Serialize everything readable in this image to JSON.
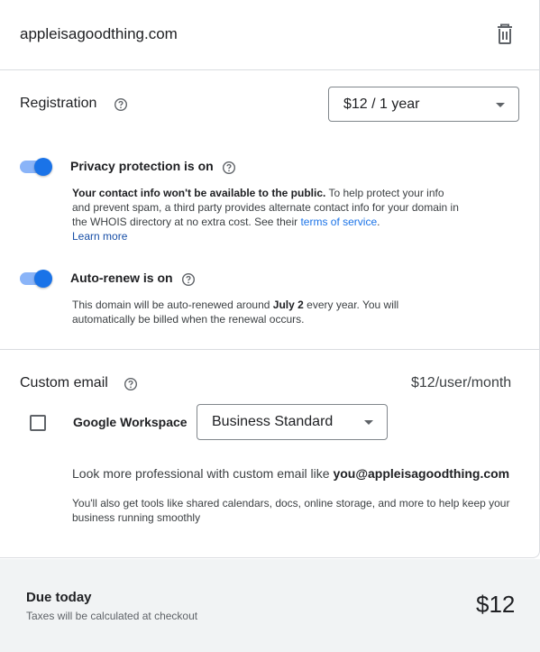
{
  "domain": {
    "name": "appleisagoodthing.com",
    "delete_icon": "trash-icon"
  },
  "registration": {
    "title": "Registration",
    "help_icon": "help-circle-icon",
    "selected_plan": "$12 / 1 year"
  },
  "privacy": {
    "label": "Privacy protection is on",
    "enabled": true,
    "desc_bold": "Your contact info won't be available to the public.",
    "desc_text": " To help protect your info and prevent spam, a third party provides alternate contact info for your domain in the WHOIS directory at no extra cost. See their ",
    "terms_link": "terms of service",
    "desc_end": ".",
    "learn_more": "Learn more"
  },
  "autorenew": {
    "label": "Auto-renew is on",
    "enabled": true,
    "desc_pre": "This domain will be auto-renewed around ",
    "renew_date": "July 2",
    "desc_post": " every year. You will automatically be billed when the renewal occurs."
  },
  "custom_email": {
    "title": "Custom email",
    "price": "$12/user/month",
    "checkbox_checked": false,
    "workspace_label": "Google Workspace",
    "selected_edition": "Business Standard",
    "pitch_pre": "Look more professional with custom email like ",
    "pitch_email": "you@appleisagoodthing.com",
    "tools_text": "You'll also get tools like shared calendars, docs, online storage, and more to help keep your business running smoothly"
  },
  "summary": {
    "due_label": "Due today",
    "tax_note": "Taxes will be calculated at checkout",
    "total": "$12"
  },
  "colors": {
    "accent": "#1a73e8",
    "toggle_track": "#8ab4f8",
    "divider": "#dadce0",
    "footer_bg": "#f1f3f4"
  }
}
